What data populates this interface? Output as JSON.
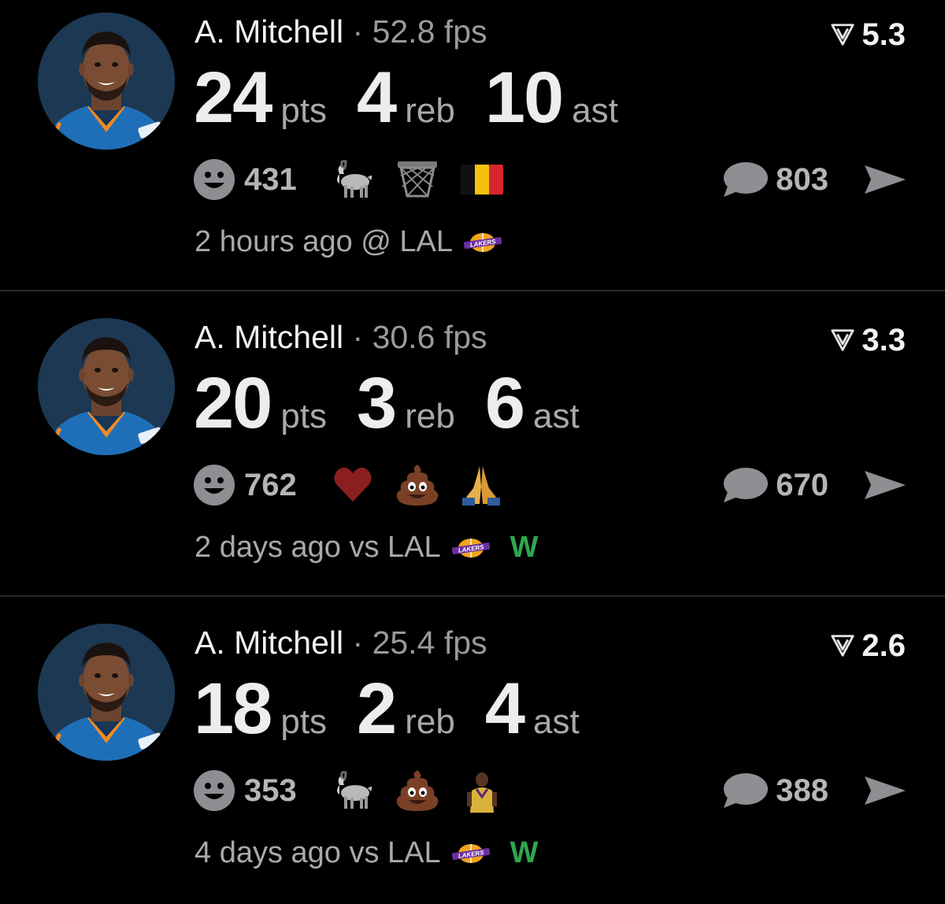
{
  "colors": {
    "background": "#000000",
    "divider": "#2a2a2c",
    "primary_text": "#ededed",
    "secondary_text": "#a9a9ad",
    "win_green": "#2fa64f"
  },
  "posts": [
    {
      "player_name": "A. Mitchell",
      "separator": "·",
      "fps_value": "52.8",
      "fps_unit": "fps",
      "rating_icon": "down-triangle-icon",
      "rating": "5.3",
      "stats": [
        {
          "value": "24",
          "unit": "pts"
        },
        {
          "value": "4",
          "unit": "reb"
        },
        {
          "value": "10",
          "unit": "ast"
        }
      ],
      "reaction_icon": "smiley-icon",
      "reaction_count": "431",
      "emojis": [
        "goat-emoji",
        "basketball-hoop-emoji",
        "belgium-flag-emoji"
      ],
      "comment_count": "803",
      "share_icon": "send-icon",
      "time_ago": "2 hours ago",
      "location": "@",
      "opponent": "LAL",
      "opponent_logo": "lakers-logo",
      "result": ""
    },
    {
      "player_name": "A. Mitchell",
      "separator": "·",
      "fps_value": "30.6",
      "fps_unit": "fps",
      "rating_icon": "down-triangle-icon",
      "rating": "3.3",
      "stats": [
        {
          "value": "20",
          "unit": "pts"
        },
        {
          "value": "3",
          "unit": "reb"
        },
        {
          "value": "6",
          "unit": "ast"
        }
      ],
      "reaction_icon": "smiley-icon",
      "reaction_count": "762",
      "emojis": [
        "heart-emoji",
        "poop-emoji",
        "praying-hands-emoji"
      ],
      "comment_count": "670",
      "share_icon": "send-icon",
      "time_ago": "2 days ago",
      "location": "vs",
      "opponent": "LAL",
      "opponent_logo": "lakers-logo",
      "result": "W"
    },
    {
      "player_name": "A. Mitchell",
      "separator": "·",
      "fps_value": "25.4",
      "fps_unit": "fps",
      "rating_icon": "down-triangle-icon",
      "rating": "2.6",
      "stats": [
        {
          "value": "18",
          "unit": "pts"
        },
        {
          "value": "2",
          "unit": "reb"
        },
        {
          "value": "4",
          "unit": "ast"
        }
      ],
      "reaction_icon": "smiley-icon",
      "reaction_count": "353",
      "emojis": [
        "goat-emoji",
        "poop-emoji",
        "player-emoji"
      ],
      "comment_count": "388",
      "share_icon": "send-icon",
      "time_ago": "4 days ago",
      "location": "vs",
      "opponent": "LAL",
      "opponent_logo": "lakers-logo",
      "result": "W"
    }
  ]
}
